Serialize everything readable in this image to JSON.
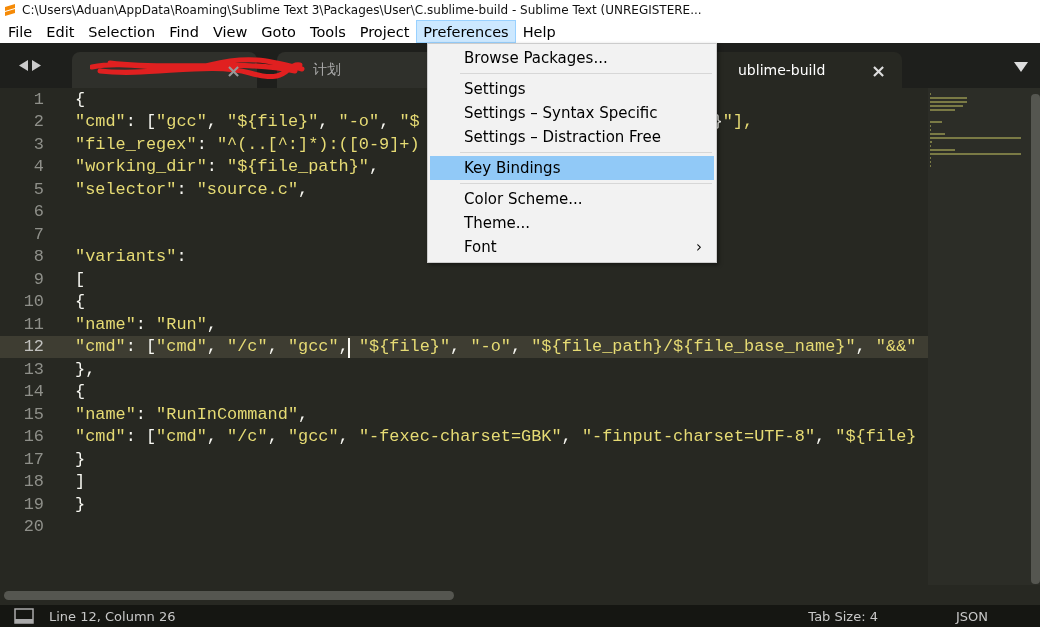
{
  "window": {
    "title": "C:\\Users\\Aduan\\AppData\\Roaming\\Sublime Text 3\\Packages\\User\\C.sublime-build - Sublime Text (UNREGISTERE..."
  },
  "menu_bar": [
    {
      "label": "File",
      "selected": false
    },
    {
      "label": "Edit",
      "selected": false
    },
    {
      "label": "Selection",
      "selected": false
    },
    {
      "label": "Find",
      "selected": false
    },
    {
      "label": "View",
      "selected": false
    },
    {
      "label": "Goto",
      "selected": false
    },
    {
      "label": "Tools",
      "selected": false
    },
    {
      "label": "Project",
      "selected": false
    },
    {
      "label": "Preferences",
      "selected": true
    },
    {
      "label": "Help",
      "selected": false
    }
  ],
  "tabs": [
    {
      "selected": false,
      "close": "×"
    },
    {
      "label": "计划",
      "selected": false
    },
    {
      "label": "ublime-build",
      "selected": true,
      "close": "×"
    }
  ],
  "dropdown": {
    "items": [
      {
        "kind": "item",
        "label": "Browse Packages...",
        "selected": false
      },
      {
        "kind": "separator"
      },
      {
        "kind": "item",
        "label": "Settings",
        "selected": false
      },
      {
        "kind": "item",
        "label": "Settings – Syntax Specific",
        "selected": false
      },
      {
        "kind": "item",
        "label": "Settings – Distraction Free",
        "selected": false
      },
      {
        "kind": "separator"
      },
      {
        "kind": "item",
        "label": "Key Bindings",
        "selected": true
      },
      {
        "kind": "separator"
      },
      {
        "kind": "item",
        "label": "Color Scheme...",
        "selected": false
      },
      {
        "kind": "item",
        "label": "Theme...",
        "selected": false
      },
      {
        "kind": "submenu",
        "label": "Font",
        "selected": false,
        "arrow": "›"
      }
    ]
  },
  "editor": {
    "lines": [
      {
        "number": "1",
        "text": "{",
        "current": false
      },
      {
        "number": "2",
        "text": "\"cmd\": [\"gcc\", \"${file}\", \"-o\", \"$",
        "tail": "}\"],",
        "current": false
      },
      {
        "number": "3",
        "text": "\"file_regex\": \"^(..[^:]*):([0-9]+)",
        "current": false
      },
      {
        "number": "4",
        "text": "\"working_dir\": \"${file_path}\",",
        "current": false
      },
      {
        "number": "5",
        "text": "\"selector\": \"source.c\",",
        "current": false
      },
      {
        "number": "6",
        "current": false
      },
      {
        "number": "7",
        "current": false
      },
      {
        "number": "8",
        "text": "\"variants\":",
        "current": false
      },
      {
        "number": "9",
        "text": "[",
        "current": false
      },
      {
        "number": "10",
        "text": "{",
        "current": false
      },
      {
        "number": "11",
        "text": "\"name\": \"Run\",",
        "current": false
      },
      {
        "number": "12",
        "text": "\"cmd\": [\"cmd\", \"/c\", \"gcc\", \"${file}\", \"-o\", \"${file_path}/${file_base_name}\", \"&&\"",
        "current": true
      },
      {
        "number": "13",
        "text": "},",
        "current": false
      },
      {
        "number": "14",
        "text": "{",
        "current": false
      },
      {
        "number": "15",
        "text": "\"name\": \"RunInCommand\",",
        "current": false
      },
      {
        "number": "16",
        "text": "\"cmd\": [\"cmd\", \"/c\", \"gcc\", \"-fexec-charset=GBK\", \"-finput-charset=UTF-8\", \"${file}",
        "current": false
      },
      {
        "number": "17",
        "text": "}",
        "current": false
      },
      {
        "number": "18",
        "text": "]",
        "current": false
      },
      {
        "number": "19",
        "text": "}",
        "current": false
      },
      {
        "number": "20",
        "current": false
      }
    ]
  },
  "status_bar": {
    "position": "Line 12, Column 26",
    "tab_size": "Tab Size: 4",
    "syntax": "JSON"
  }
}
